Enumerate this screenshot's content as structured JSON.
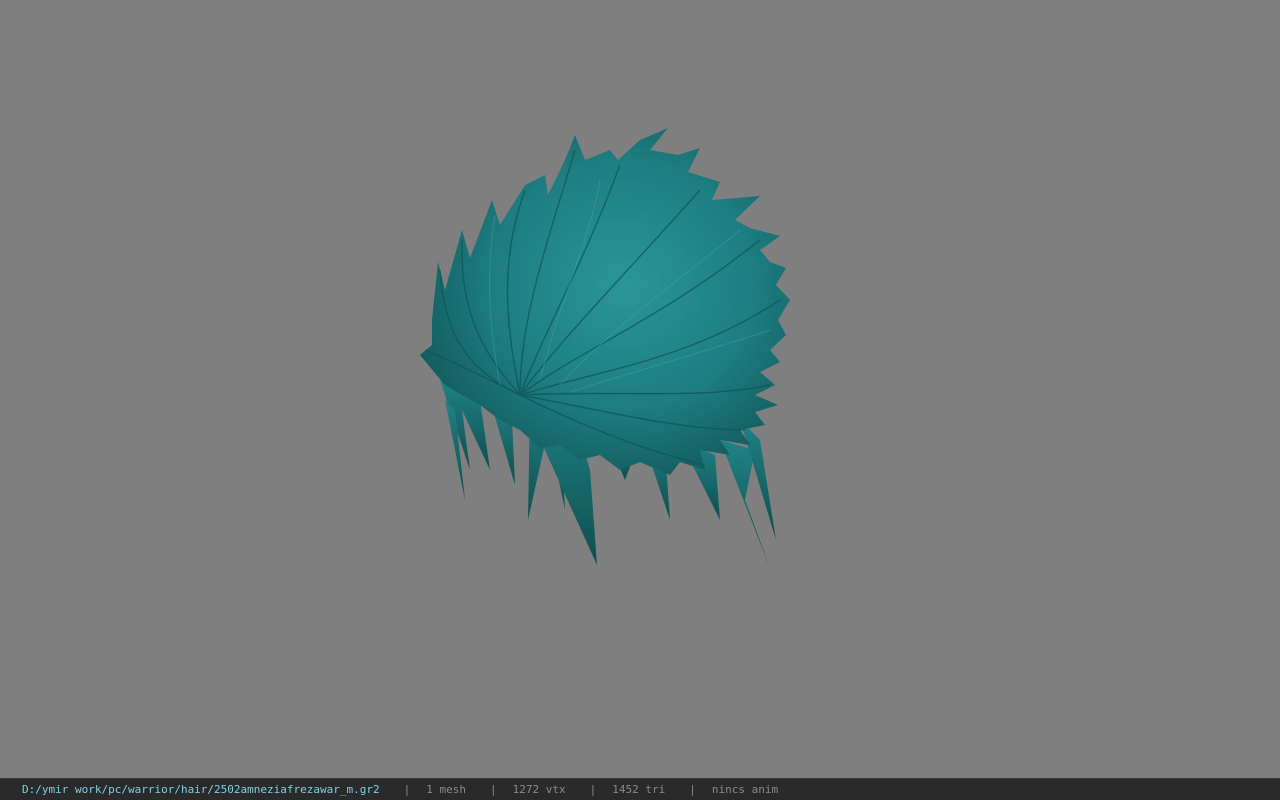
{
  "viewport": {
    "background_color": "#7f7f7f",
    "model": {
      "icon": "hair-mesh-model",
      "color": "#1e7f82"
    }
  },
  "status_bar": {
    "file_path": "D:/ymir work/pc/warrior/hair/2502amneziafrezawar_m.gr2",
    "mesh_count": "1 mesh",
    "vertex_count": "1272 vtx",
    "triangle_count": "1452 tri",
    "animation": "nincs anim",
    "separator": "|",
    "path_color": "#7fd0e0",
    "text_color": "#8a8a8a"
  }
}
